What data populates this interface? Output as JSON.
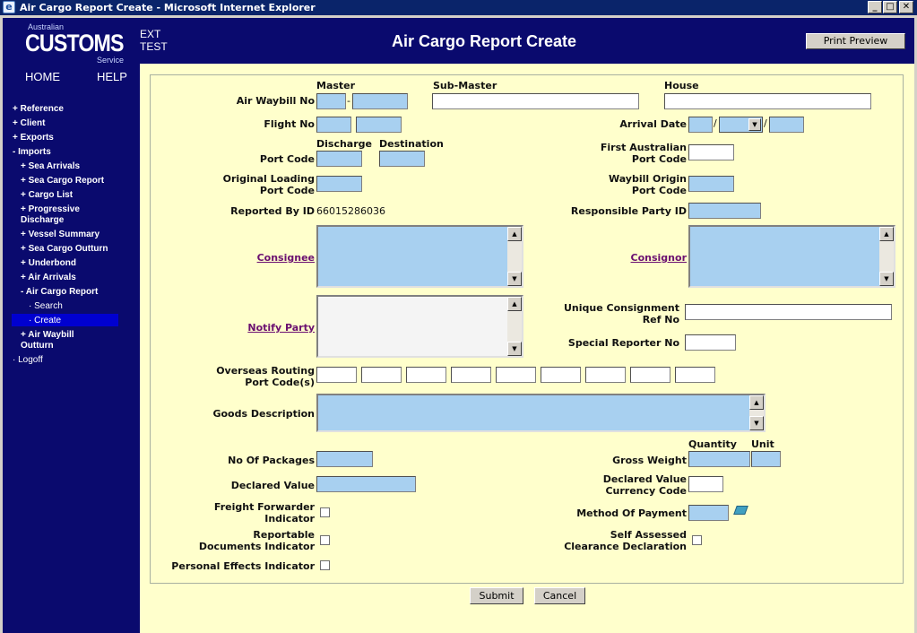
{
  "window": {
    "title": "Air Cargo Report Create - Microsoft Internet Explorer",
    "min": "_",
    "max": "□",
    "close": "✕",
    "ie_glyph": "e"
  },
  "header": {
    "logo_top": "Australian",
    "logo_main": "CUSTOMS",
    "logo_sub": "Service",
    "env_line1": "EXT",
    "env_line2": "TEST",
    "page_title": "Air Cargo Report Create",
    "print_preview": "Print Preview"
  },
  "topnav": {
    "home": "HOME",
    "help": "HELP"
  },
  "sidebar": [
    {
      "label": "+ Reference"
    },
    {
      "label": "+ Client"
    },
    {
      "label": "+ Exports"
    },
    {
      "label": "- Imports"
    },
    {
      "label": "+ Sea Arrivals"
    },
    {
      "label": "+ Sea Cargo Report"
    },
    {
      "label": "+ Cargo List"
    },
    {
      "label": "+ Progressive"
    },
    {
      "label": "Discharge"
    },
    {
      "label": "+ Vessel Summary"
    },
    {
      "label": "+ Sea Cargo Outturn"
    },
    {
      "label": "+ Underbond"
    },
    {
      "label": "+ Air Arrivals"
    },
    {
      "label": "- Air Cargo Report"
    },
    {
      "label": "· Search"
    },
    {
      "label": "· Create"
    },
    {
      "label": "+ Air Waybill"
    },
    {
      "label": "Outturn"
    },
    {
      "label": "· Logoff"
    }
  ],
  "form": {
    "col_master": "Master",
    "col_submaster": "Sub-Master",
    "col_house": "House",
    "air_waybill_no": "Air Waybill No",
    "flight_no": "Flight No",
    "arrival_date": "Arrival Date",
    "col_discharge": "Discharge",
    "col_destination": "Destination",
    "port_code": "Port Code",
    "first_aus_1": "First Australian",
    "first_aus_2": "Port Code",
    "orig_load_1": "Original Loading",
    "orig_load_2": "Port Code",
    "waybill_origin_1": "Waybill Origin",
    "waybill_origin_2": "Port Code",
    "reported_by_id": "Reported By ID",
    "reported_by_value": "66015286036",
    "responsible_party_id": "Responsible Party ID",
    "consignee": "Consignee",
    "consignor": "Consignor",
    "notify_party": "Notify Party",
    "unique_ref_1": "Unique Consignment",
    "unique_ref_2": "Ref No",
    "special_reporter_no": "Special Reporter No",
    "overseas_routing_1": "Overseas Routing",
    "overseas_routing_2": "Port Code(s)",
    "goods_description": "Goods Description",
    "col_quantity": "Quantity",
    "col_unit": "Unit",
    "no_of_packages": "No Of Packages",
    "gross_weight": "Gross Weight",
    "declared_value": "Declared Value",
    "declared_currency_1": "Declared Value",
    "declared_currency_2": "Currency Code",
    "freight_fwd_1": "Freight Forwarder",
    "freight_fwd_2": "Indicator",
    "method_of_payment": "Method Of Payment",
    "reportable_docs_1": "Reportable",
    "reportable_docs_2": "Documents Indicator",
    "self_assessed_1": "Self Assessed",
    "self_assessed_2": "Clearance Declaration",
    "personal_effects": "Personal Effects Indicator",
    "slash": "/",
    "dash": "-"
  },
  "buttons": {
    "submit": "Submit",
    "cancel": "Cancel"
  },
  "icons": {
    "up": "▲",
    "down": "▼",
    "dropdown": "▼",
    "book": "book-icon"
  }
}
